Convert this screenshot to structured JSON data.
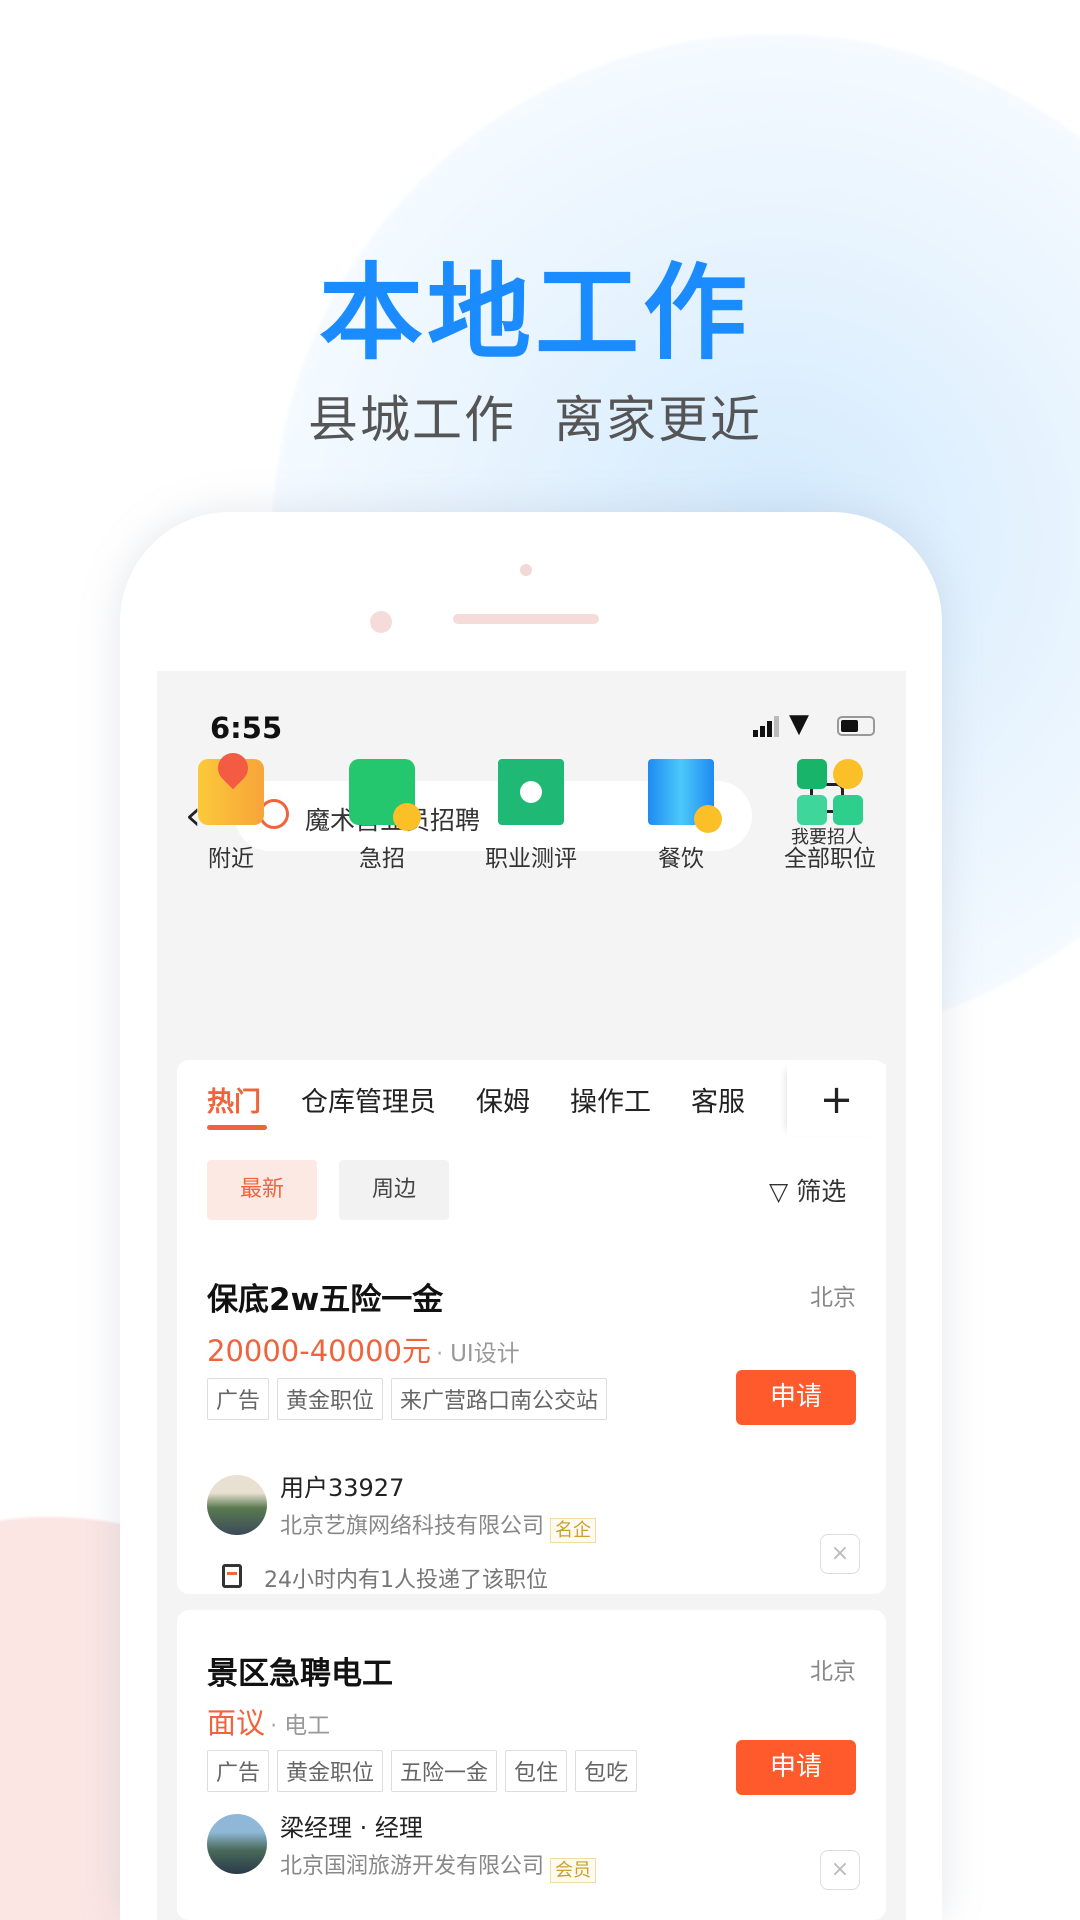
{
  "hero": {
    "title": "本地工作",
    "subtitle": "县城工作  离家更近"
  },
  "status_bar": {
    "time": "6:55"
  },
  "search": {
    "value": "魔术营业员招聘",
    "recruit_label": "我要招人"
  },
  "shortcuts": [
    {
      "label": "附近",
      "icon": "map-pin-icon"
    },
    {
      "label": "急招",
      "icon": "urgent-bag-icon"
    },
    {
      "label": "职业测评",
      "icon": "assessment-clipboard-icon"
    },
    {
      "label": "餐饮",
      "icon": "food-book-icon"
    },
    {
      "label": "全部职位",
      "icon": "all-categories-grid-icon"
    }
  ],
  "tabs": [
    "热门",
    "仓库管理员",
    "保姆",
    "操作工",
    "客服"
  ],
  "filters": {
    "chips": [
      "最新",
      "周边"
    ],
    "filter_label": "筛选"
  },
  "jobs": [
    {
      "title": "保底2w五险一金",
      "city": "北京",
      "salary": "20000-40000元",
      "category": "UI设计",
      "tags": [
        "广告",
        "黄金职位",
        "来广营路口南公交站"
      ],
      "apply": "申请",
      "poster": "用户33927",
      "company": "北京艺旗网络科技有限公司",
      "badge": "名企",
      "note": "24小时内有1人投递了该职位"
    },
    {
      "title": "景区急聘电工",
      "city": "北京",
      "salary": "面议",
      "category": "电工",
      "tags": [
        "广告",
        "黄金职位",
        "五险一金",
        "包住",
        "包吃"
      ],
      "apply": "申请",
      "poster": "梁经理 · 经理",
      "company": "北京国润旅游开发有限公司",
      "badge": "会员"
    }
  ],
  "colors": {
    "brand_blue": "#1a8cff",
    "accent": "#ff5a2c"
  }
}
